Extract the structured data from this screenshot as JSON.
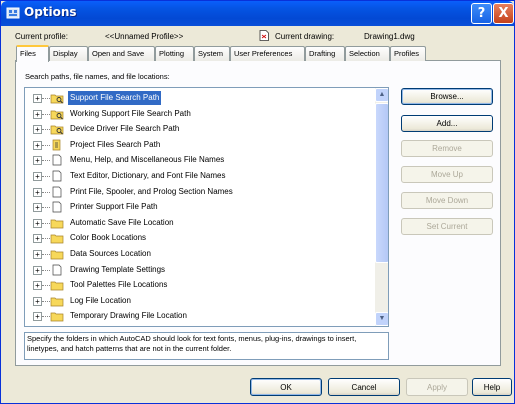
{
  "window": {
    "title": "Options",
    "help_glyph": "?",
    "close_glyph": "X"
  },
  "profile": {
    "label": "Current profile:",
    "value": "<<Unnamed Profile>>",
    "drawing_label": "Current drawing:",
    "drawing_value": "Drawing1.dwg"
  },
  "tabs": [
    {
      "label": "Files",
      "active": true
    },
    {
      "label": "Display"
    },
    {
      "label": "Open and Save"
    },
    {
      "label": "Plotting"
    },
    {
      "label": "System"
    },
    {
      "label": "User Preferences"
    },
    {
      "label": "Drafting"
    },
    {
      "label": "Selection"
    },
    {
      "label": "Profiles"
    }
  ],
  "files": {
    "section_label": "Search paths, file names, and file locations:",
    "items": [
      {
        "label": "Support File Search Path",
        "icon": "folder-search-icon",
        "selected": true
      },
      {
        "label": "Working Support File Search Path",
        "icon": "folder-search-icon"
      },
      {
        "label": "Device Driver File Search Path",
        "icon": "folder-search-icon"
      },
      {
        "label": "Project Files Search Path",
        "icon": "project-file-icon"
      },
      {
        "label": "Menu, Help, and Miscellaneous File Names",
        "icon": "document-icon"
      },
      {
        "label": "Text Editor, Dictionary, and Font File Names",
        "icon": "document-icon"
      },
      {
        "label": "Print File, Spooler, and Prolog Section Names",
        "icon": "document-icon"
      },
      {
        "label": "Printer Support File Path",
        "icon": "document-icon"
      },
      {
        "label": "Automatic Save File Location",
        "icon": "folder-icon"
      },
      {
        "label": "Color Book Locations",
        "icon": "folder-icon"
      },
      {
        "label": "Data Sources Location",
        "icon": "folder-icon"
      },
      {
        "label": "Drawing Template Settings",
        "icon": "document-icon"
      },
      {
        "label": "Tool Palettes File Locations",
        "icon": "folder-icon"
      },
      {
        "label": "Log File Location",
        "icon": "folder-icon"
      },
      {
        "label": "Temporary Drawing File Location",
        "icon": "folder-icon"
      }
    ],
    "description": "Specify the folders in which AutoCAD should look for text fonts, menus, plug-ins, drawings to insert, linetypes, and hatch patterns that are not in the current folder.",
    "buttons": {
      "browse": "Browse...",
      "add": "Add...",
      "remove": "Remove",
      "move_up": "Move Up",
      "move_down": "Move Down",
      "set_current": "Set Current"
    }
  },
  "footer": {
    "ok": "OK",
    "cancel": "Cancel",
    "apply": "Apply",
    "help": "Help"
  },
  "colors": {
    "titlebar": "#0554e3",
    "selection": "#316ac5",
    "dialog_bg": "#ece9d8",
    "folder": "#f7d85a"
  }
}
